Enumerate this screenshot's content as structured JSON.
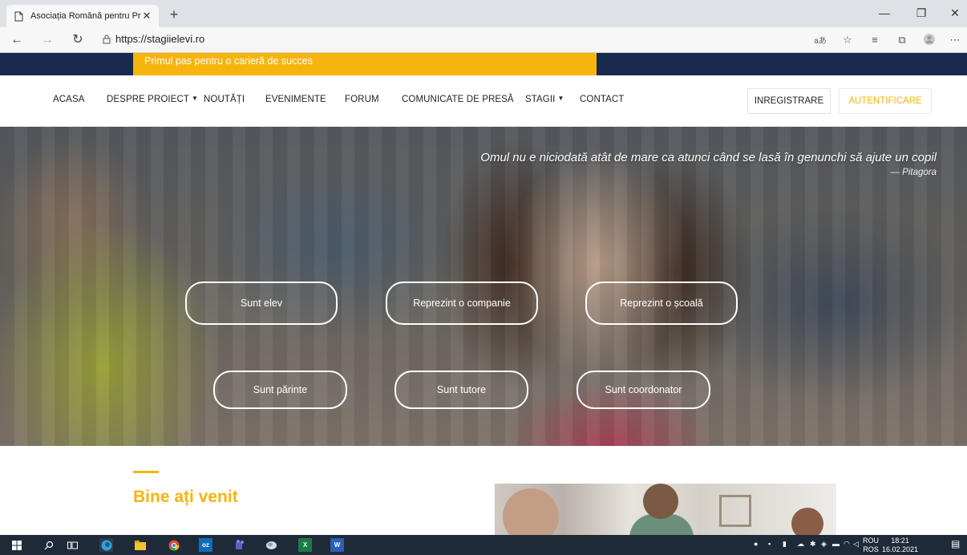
{
  "browser": {
    "tab_title": "Asociația Română pentru Promo",
    "url": "https://stagiielevi.ro",
    "read_aloud": "aあ",
    "new_tab": "+"
  },
  "site": {
    "tagline": "Primul pas pentru o carieră de succes",
    "nav": {
      "items": [
        "ACASA",
        "DESPRE PROIECT",
        "NOUTĂȚI",
        "EVENIMENTE",
        "FORUM",
        "COMUNICATE DE PRESĂ",
        "STAGII",
        "CONTACT"
      ],
      "register": "INREGISTRARE",
      "login": "AUTENTIFICARE"
    },
    "hero": {
      "quote": "Omul nu e niciodată atât de mare ca atunci când se lasă în genunchi să ajute un copil",
      "author": "— Pitagora",
      "buttons": [
        "Sunt elev",
        "Reprezint o companie",
        "Reprezint o școală",
        "Sunt părinte",
        "Sunt tutore",
        "Sunt coordonator"
      ]
    },
    "welcome_title": "Bine ați venit"
  },
  "taskbar": {
    "lang_top": "ROU",
    "lang_bottom": "ROS",
    "time": "18:21",
    "date": "16.02.2021"
  },
  "colors": {
    "accent": "#f6b40e",
    "top_strip": "#1a2a4e",
    "taskbar": "#1f2a38"
  }
}
